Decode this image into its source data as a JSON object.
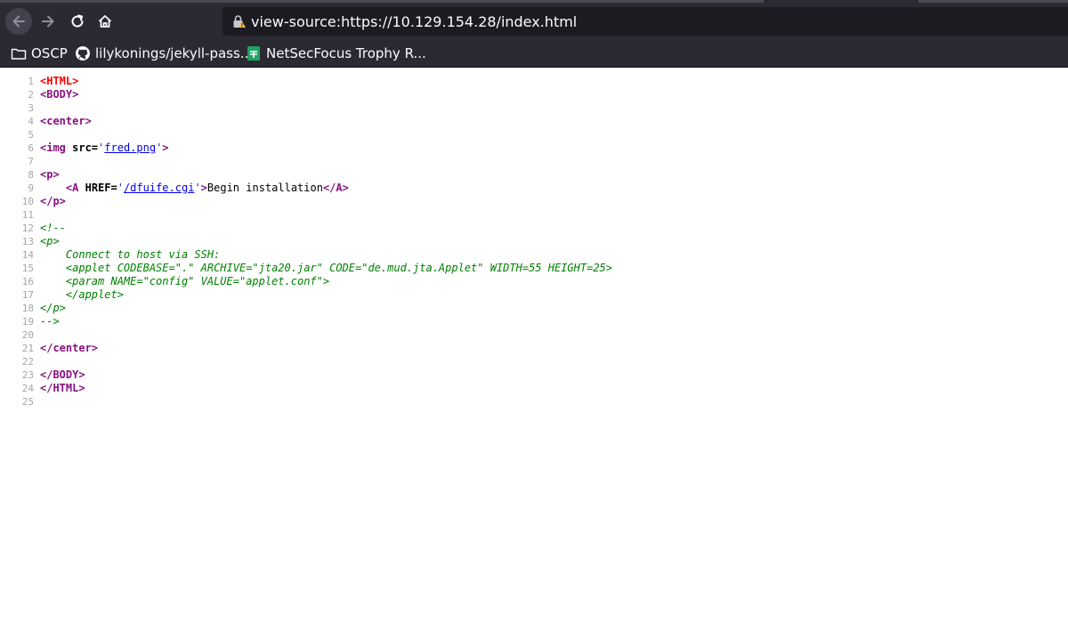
{
  "browser": {
    "url": "view-source:https://10.129.154.28/index.html",
    "buttons": {
      "back": "back",
      "forward": "forward",
      "reload": "reload",
      "home": "home"
    },
    "bookmarks": [
      {
        "label": "OSCP",
        "icon": "folder-icon"
      },
      {
        "label": "lilykonings/jekyll-pass...",
        "icon": "github-icon"
      },
      {
        "label": "NetSecFocus Trophy R...",
        "icon": "sheets-icon"
      }
    ],
    "colors": {
      "chrome_bg": "#2b2a33",
      "urlbar_bg": "#1c1b22",
      "text": "#fbfbfe"
    }
  },
  "source": {
    "line_numbers": [
      "1",
      "2",
      "3",
      "4",
      "5",
      "6",
      "7",
      "8",
      "9",
      "10",
      "11",
      "12",
      "13",
      "14",
      "15",
      "16",
      "17",
      "18",
      "19",
      "20",
      "21",
      "22",
      "23",
      "24",
      "25"
    ],
    "l1": "<HTML>",
    "l2": "<BODY>",
    "l4": "<center>",
    "l6_open": "<img ",
    "l6_attr": "src=",
    "l6_q1": "'",
    "l6_val": "fred.png",
    "l6_q2": "'",
    "l6_close": ">",
    "l8": "<p>",
    "l9_indent": "    ",
    "l9_open": "<A ",
    "l9_attr": "HREF=",
    "l9_q1": "'",
    "l9_val": "/dfuife.cgi",
    "l9_q2": "'",
    "l9_close": ">",
    "l9_text": "Begin installation",
    "l9_end": "</A>",
    "l10": "</p>",
    "l12": "<!--",
    "l13": "<p>",
    "l14": "    Connect to host via SSH:",
    "l15": "    <applet CODEBASE=\".\" ARCHIVE=\"jta20.jar\" CODE=\"de.mud.jta.Applet\" WIDTH=55 HEIGHT=25>",
    "l16": "    <param NAME=\"config\" VALUE=\"applet.conf\">",
    "l17": "    </applet>",
    "l18": "</p>",
    "l19": "-->",
    "l21": "</center>",
    "l23": "</BODY>",
    "l24": "</HTML>"
  }
}
